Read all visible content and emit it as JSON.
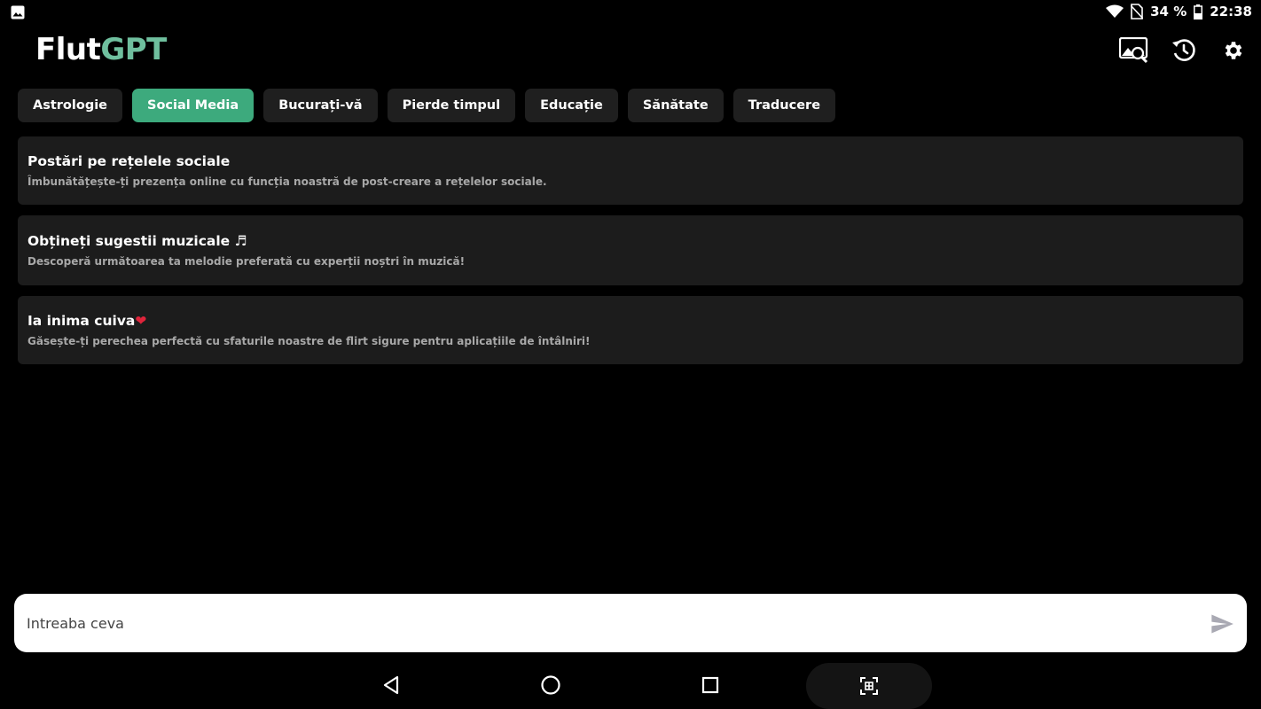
{
  "status_bar": {
    "battery": "34 %",
    "time": "22:38"
  },
  "header": {
    "title_part1": "Flut",
    "title_part2": "GPT",
    "icons": [
      "image-search-icon",
      "history-icon",
      "settings-gear-icon"
    ]
  },
  "tabs": [
    {
      "label": "Astrologie",
      "active": false
    },
    {
      "label": "Social Media",
      "active": true
    },
    {
      "label": "Bucurați-vă",
      "active": false
    },
    {
      "label": "Pierde timpul",
      "active": false
    },
    {
      "label": "Educație",
      "active": false
    },
    {
      "label": "Sănătate",
      "active": false
    },
    {
      "label": "Traducere",
      "active": false
    }
  ],
  "cards": [
    {
      "title": "Postări pe rețelele sociale",
      "description": "Îmbunătățește-ți prezența online cu funcția noastră de post-creare a rețelelor sociale."
    },
    {
      "title": "Obțineți sugestii muzicale ♬",
      "description": "Descoperă următoarea ta melodie preferată cu experții noștri în muzică!"
    },
    {
      "title": "Ia inima cuiva",
      "title_emoji": "❤",
      "description": "Găsește-ți perechea perfectă cu sfaturile noastre de flirt sigure pentru aplicațiile de întâlniri!"
    }
  ],
  "input": {
    "placeholder": "Intreaba ceva",
    "value": ""
  },
  "colors": {
    "accent": "#3daa7d",
    "title_accent": "#6fbf9e",
    "card_bg": "#1c1c1c",
    "tab_bg": "#1f1f1f",
    "background": "#000000"
  }
}
